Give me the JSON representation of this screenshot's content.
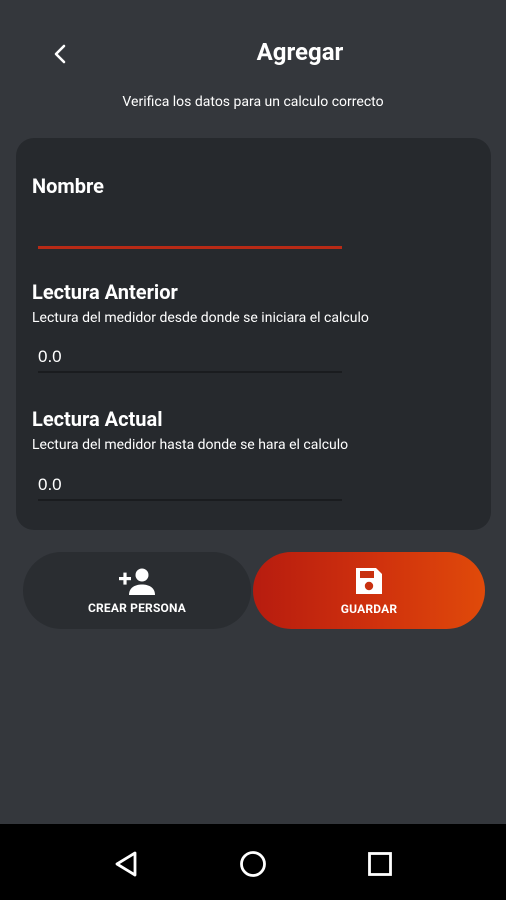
{
  "header": {
    "title": "Agregar",
    "subtitle": "Verifica los datos para un calculo correcto"
  },
  "form": {
    "nombre": {
      "label": "Nombre",
      "value": ""
    },
    "lectura_anterior": {
      "label": "Lectura Anterior",
      "help": "Lectura del medidor desde donde se iniciara el calculo",
      "value": "0.0"
    },
    "lectura_actual": {
      "label": "Lectura Actual",
      "help": "Lectura del medidor hasta donde se hara el calculo",
      "value": "0.0"
    }
  },
  "actions": {
    "crear_persona": {
      "label": "CREAR PERSONA",
      "icon": "person-add-icon"
    },
    "guardar": {
      "label": "GUARDAR",
      "icon": "save-icon"
    }
  },
  "colors": {
    "background": "#34373c",
    "card": "#26292d",
    "accent": "#c72b12"
  },
  "system_nav": {
    "back": "nav-back-icon",
    "home": "nav-home-icon",
    "recents": "nav-recents-icon"
  }
}
